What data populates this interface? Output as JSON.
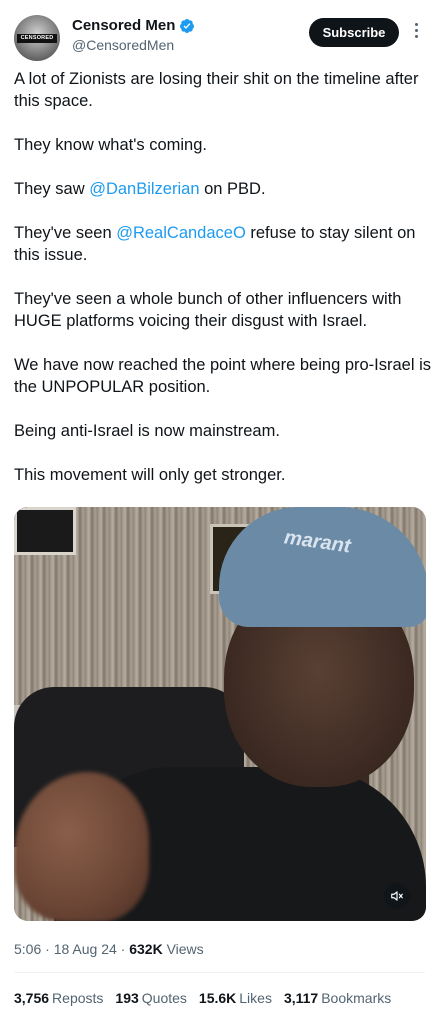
{
  "author": {
    "display_name": "Censored Men",
    "handle": "@CensoredMen",
    "avatar_text": "CENSORED",
    "verified_color": "#1d9bf0"
  },
  "header": {
    "subscribe_label": "Subscribe"
  },
  "tweet": {
    "p1": "A lot of Zionists are losing their shit on the timeline after this space.",
    "p2": "They know what's coming.",
    "p3_before": "They saw ",
    "p3_mention": "@DanBilzerian",
    "p3_after": " on PBD.",
    "p4_before": "They've seen ",
    "p4_mention": "@RealCandaceO",
    "p4_after": " refuse to stay silent on this issue.",
    "p5": "They've seen a whole bunch of other influencers with HUGE platforms voicing their disgust with Israel.",
    "p6": "We have now reached the point where being pro-Israel is the UNPOPULAR position.",
    "p7": "Being anti-Israel is now mainstream.",
    "p8": "This movement will only get stronger."
  },
  "media": {
    "cap_text": "marant"
  },
  "meta": {
    "time": "5:06",
    "separator": "·",
    "date": "18 Aug 24",
    "views_count": "632K",
    "views_label": "Views"
  },
  "stats": {
    "reposts_count": "3,756",
    "reposts_label": "Reposts",
    "quotes_count": "193",
    "quotes_label": "Quotes",
    "likes_count": "15.6K",
    "likes_label": "Likes",
    "bookmarks_count": "3,117",
    "bookmarks_label": "Bookmarks"
  },
  "colors": {
    "link": "#1d9bf0",
    "text": "#0f1419",
    "secondary": "#536471"
  }
}
